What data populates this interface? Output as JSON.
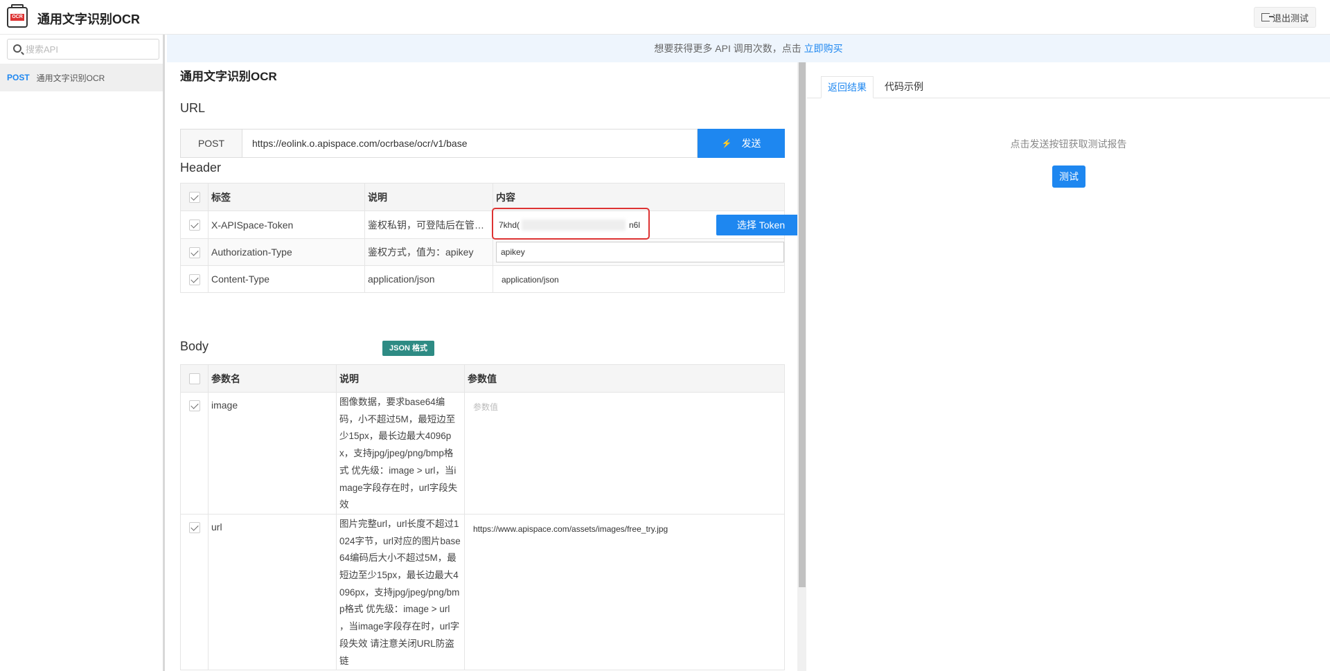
{
  "header": {
    "title": "通用文字识别OCR",
    "logo_text": "OCR",
    "exit_label": "退出测试"
  },
  "sidebar": {
    "search_placeholder": "搜索API",
    "items": [
      {
        "method": "POST",
        "name": "通用文字识别OCR"
      }
    ]
  },
  "banner": {
    "text": "想要获得更多 API 调用次数，点击 ",
    "link": "立即购买"
  },
  "main": {
    "title": "通用文字识别OCR",
    "url_section": "URL",
    "method": "POST",
    "url": "https://eolink.o.apispace.com/ocrbase/ocr/v1/base",
    "send_label": "发送",
    "header_section": "Header",
    "header_columns": [
      "标签",
      "说明",
      "内容"
    ],
    "header_rows": [
      {
        "label": "X-APISpace-Token",
        "desc": "鉴权私钥，可登陆后在管…",
        "value_start": "7khd(",
        "value_end": "n6l",
        "token_button": "选择 Token"
      },
      {
        "label": "Authorization-Type",
        "desc": "鉴权方式，值为：apikey",
        "value": "apikey"
      },
      {
        "label": "Content-Type",
        "desc": "application/json",
        "value": "application/json"
      }
    ],
    "body_section": "Body",
    "body_badge": "JSON 格式",
    "body_columns": [
      "参数名",
      "说明",
      "参数值"
    ],
    "body_rows": [
      {
        "name": "image",
        "desc": "图像数据，要求base64编码，小不超过5M，最短边至少15px，最长边最大4096px，支持jpg/jpeg/png/bmp格式 优先级：image > url，当image字段存在时，url字段失效",
        "placeholder": "参数值"
      },
      {
        "name": "url",
        "desc": "图片完整url，url长度不超过1024字节，url对应的图片base64编码后大小不超过5M，最短边至少15px，最长边最大4096px，支持jpg/jpeg/png/bmp格式 优先级：image > url ，当image字段存在时，url字段失效 请注意关闭URL防盗链",
        "value": "https://www.apispace.com/assets/images/free_try.jpg"
      }
    ]
  },
  "right": {
    "tabs": [
      "返回结果",
      "代码示例"
    ],
    "hint": "点击发送按钮获取测试报告",
    "test_label": "测试"
  }
}
